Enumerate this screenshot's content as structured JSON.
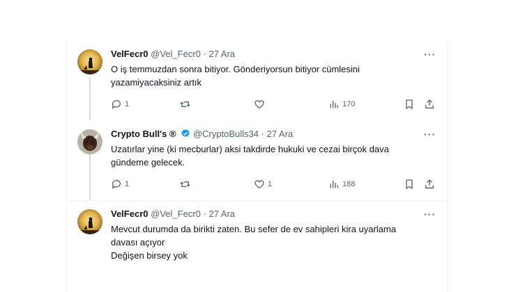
{
  "tweets": [
    {
      "display_name": "VelFecr0",
      "handle": "@Vel_Fecr0",
      "separator": "·",
      "date": "27 Ara",
      "text_lines": [
        "O iş temmuzdan sonra bitiyor. Gönderiyorsun bitiyor cümlesini",
        "yazamiyacaksiniz artık"
      ],
      "replies": "1",
      "retweets": "",
      "likes": "",
      "views": "170"
    },
    {
      "display_name": "Crypto Bull's ®",
      "handle": "@CryptoBulls34",
      "separator": "·",
      "date": "27 Ara",
      "verified": true,
      "text_lines": [
        "Uzatırlar yine (ki mecburlar) aksi takdirde hukuki ve cezai birçok dava",
        "gündeme gelecek."
      ],
      "replies": "1",
      "retweets": "",
      "likes": "1",
      "views": "188"
    },
    {
      "display_name": "VelFecr0",
      "handle": "@Vel_Fecr0",
      "separator": "·",
      "date": "27 Ara",
      "text_lines": [
        "Mevcut durumda da birikti zaten. Bu sefer de ev sahipleri kira uyarlama",
        "davası açıyor",
        "Değişen birsey yok"
      ]
    }
  ],
  "more_label": "···",
  "colors": {
    "accent": "#1d9bf0",
    "muted": "#536471",
    "thread": "#cfd9de"
  }
}
